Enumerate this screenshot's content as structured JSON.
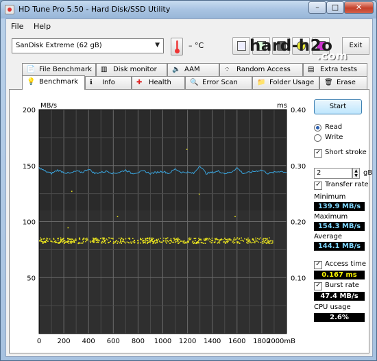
{
  "window": {
    "title": "HD Tune Pro 5.50 - Hard Disk/SSD Utility"
  },
  "menu": {
    "file": "File",
    "help": "Help"
  },
  "toolbar": {
    "drive": "SanDisk Extreme (62 gB)",
    "temperature": "– °C",
    "exit_label": "Exit"
  },
  "watermark": {
    "main": "hard-h2o",
    "sub": ".com"
  },
  "tabs_top": [
    "File Benchmark",
    "Disk monitor",
    "AAM",
    "Random Access",
    "Extra tests"
  ],
  "tabs_bottom": [
    "Benchmark",
    "Info",
    "Health",
    "Error Scan",
    "Folder Usage",
    "Erase"
  ],
  "active_tab": "Benchmark",
  "side": {
    "start_label": "Start",
    "read_label": "Read",
    "write_label": "Write",
    "mode": "Read",
    "short_stroke_label": "Short stroke",
    "short_stroke_checked": true,
    "short_stroke_value": "2",
    "short_stroke_unit": "gB",
    "transfer_rate_label": "Transfer rate",
    "transfer_rate_checked": true,
    "minimum_label": "Minimum",
    "minimum_value": "139.9 MB/s",
    "maximum_label": "Maximum",
    "maximum_value": "154.3 MB/s",
    "average_label": "Average",
    "average_value": "144.1 MB/s",
    "access_time_label": "Access time",
    "access_time_checked": true,
    "access_time_value": "0.167 ms",
    "burst_rate_label": "Burst rate",
    "burst_rate_checked": true,
    "burst_rate_value": "47.4 MB/s",
    "cpu_usage_label": "CPU usage",
    "cpu_usage_value": "2.6%"
  },
  "chart_data": {
    "type": "line",
    "left_axis_label": "MB/s",
    "right_axis_label": "ms",
    "x_unit": "mB",
    "x_ticks": [
      "0",
      "200",
      "400",
      "600",
      "800",
      "1000",
      "1200",
      "1400",
      "1600",
      "1800",
      "2000mB"
    ],
    "y_ticks_left": [
      "200",
      "150",
      "100",
      "50"
    ],
    "y_ticks_right": [
      "0.40",
      "0.30",
      "0.20",
      "0.10"
    ],
    "xlim": [
      0,
      2000
    ],
    "ylim_left": [
      0,
      200
    ],
    "ylim_right": [
      0,
      0.4
    ],
    "grid": true,
    "series": [
      {
        "name": "Transfer rate",
        "color": "#3aa6e0",
        "x": [
          0,
          50,
          100,
          150,
          200,
          250,
          300,
          350,
          400,
          450,
          500,
          550,
          600,
          650,
          700,
          750,
          800,
          850,
          900,
          950,
          1000,
          1050,
          1100,
          1150,
          1200,
          1250,
          1300,
          1350,
          1400,
          1450,
          1500,
          1550,
          1600,
          1650,
          1700,
          1750,
          1800,
          1850,
          1900,
          1950,
          2000
        ],
        "y": [
          148,
          145,
          143,
          146,
          144,
          143,
          145,
          144,
          147,
          143,
          144,
          145,
          143,
          144,
          146,
          143,
          144,
          145,
          143,
          144,
          145,
          143,
          147,
          144,
          144,
          143,
          150,
          143,
          144,
          145,
          143,
          144,
          148,
          143,
          144,
          145,
          146,
          143,
          144,
          145,
          144
        ]
      },
      {
        "name": "Access time",
        "color": "#e8e21e",
        "marker": "dot",
        "y_range_ms": [
          0.162,
          0.172
        ],
        "typical_ms": 0.167
      }
    ]
  }
}
